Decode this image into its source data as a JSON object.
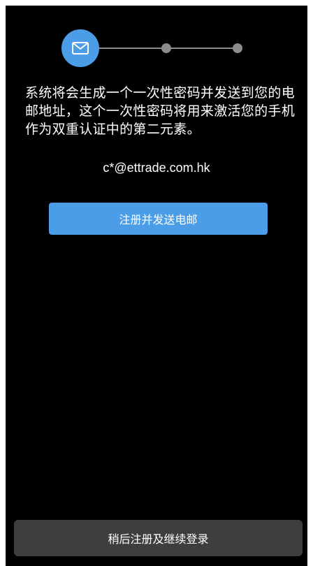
{
  "stepper": {
    "current_step": 1,
    "total_steps": 3,
    "active_step_icon": "envelope-icon",
    "colors": {
      "active": "#4a9de6",
      "inactive": "#8c8c8c"
    }
  },
  "description": "系统将会生成一个一次性密码并发送到您的电邮地址，这个一次性密码将用来激活您的手机作为双重认证中的第二元素。",
  "email": "c*@ettrade.com.hk",
  "primary_button": {
    "label": "注册并发送电邮",
    "color": "#4a9de6"
  },
  "secondary_button": {
    "label": "稍后注册及继续登录",
    "color": "#3e3e3e"
  },
  "background_color": "#000000"
}
